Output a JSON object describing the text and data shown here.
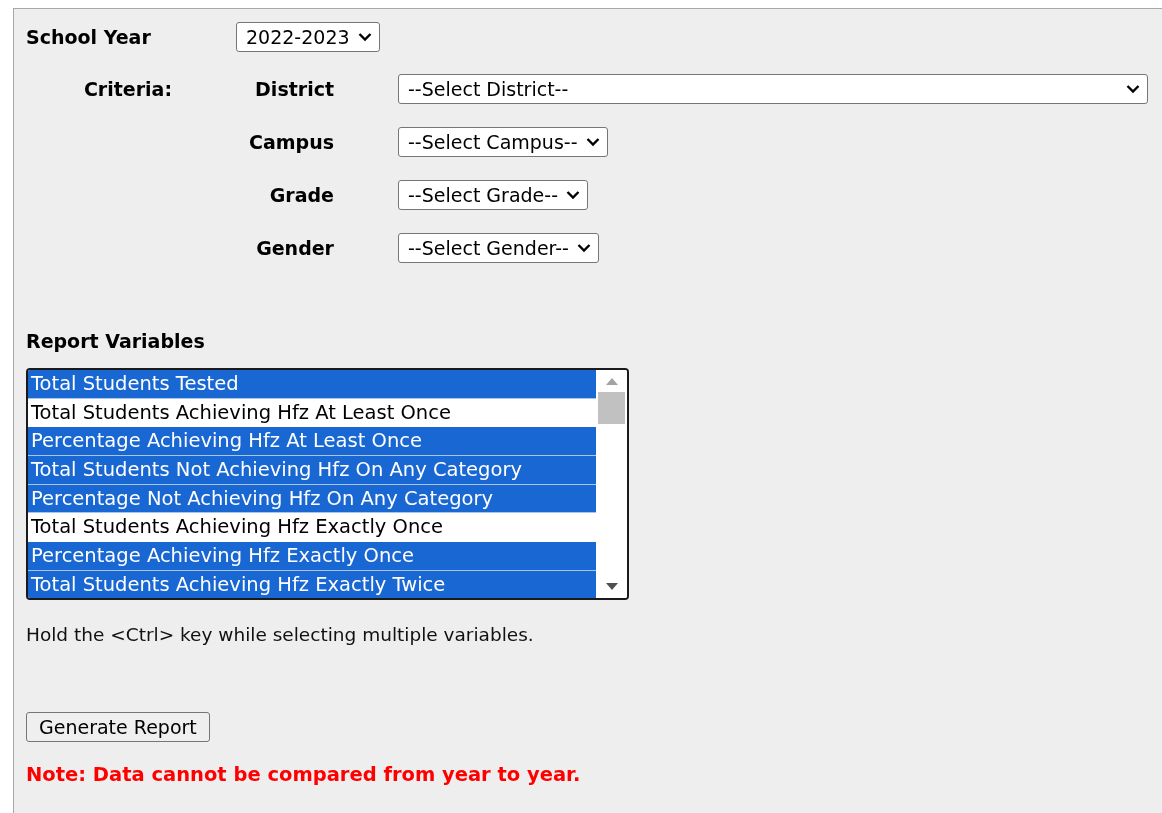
{
  "school_year": {
    "label": "School Year",
    "value": "2022-2023"
  },
  "criteria": {
    "label": "Criteria:",
    "fields": [
      {
        "label": "District",
        "value": "--Select District--",
        "kind": "wide"
      },
      {
        "label": "Campus",
        "value": "--Select Campus--",
        "kind": "narrow"
      },
      {
        "label": "Grade",
        "value": "--Select Grade--",
        "kind": "narrow"
      },
      {
        "label": "Gender",
        "value": "--Select Gender--",
        "kind": "narrow"
      }
    ]
  },
  "report_variables": {
    "label": "Report Variables",
    "items": [
      {
        "label": "Total Students Tested",
        "selected": true
      },
      {
        "label": "Total Students Achieving Hfz At Least Once",
        "selected": false
      },
      {
        "label": "Percentage Achieving Hfz At Least Once",
        "selected": true
      },
      {
        "label": "Total Students Not Achieving Hfz On Any Category",
        "selected": true
      },
      {
        "label": "Percentage Not Achieving Hfz On Any Category",
        "selected": true
      },
      {
        "label": "Total Students Achieving Hfz Exactly Once",
        "selected": false
      },
      {
        "label": "Percentage Achieving Hfz Exactly Once",
        "selected": true
      },
      {
        "label": "Total Students Achieving Hfz Exactly Twice",
        "selected": true
      }
    ],
    "hint": "Hold the <Ctrl> key while selecting multiple variables."
  },
  "generate_button": "Generate Report",
  "note": "Note: Data cannot be compared from year to year."
}
